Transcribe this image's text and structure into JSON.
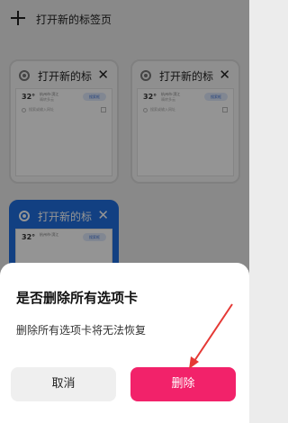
{
  "header": {
    "new_tab_label": "打开新的标签页"
  },
  "tabs": [
    {
      "title": "打开新的标",
      "weather_temp": "32°",
      "location": "杭州市·滨江",
      "location_sub": "晴转多云",
      "pill": "搜索框",
      "search_hint": "搜索或输入网址"
    },
    {
      "title": "打开新的标",
      "weather_temp": "32°",
      "location": "杭州市·滨江",
      "location_sub": "晴转多云",
      "pill": "搜索框",
      "search_hint": "搜索或输入网址"
    },
    {
      "title": "打开新的标",
      "weather_temp": "32°",
      "location": "杭州市·滨江",
      "location_sub": "晴转多云",
      "pill": "搜索框",
      "search_hint": "搜索或输入网址"
    }
  ],
  "dialog": {
    "title": "是否删除所有选项卡",
    "message": "删除所有选项卡将无法恢复",
    "cancel_label": "取消",
    "delete_label": "删除"
  },
  "colors": {
    "accent": "#f2226a",
    "active_tab": "#1f6fe0",
    "annotation": "#e53935"
  }
}
